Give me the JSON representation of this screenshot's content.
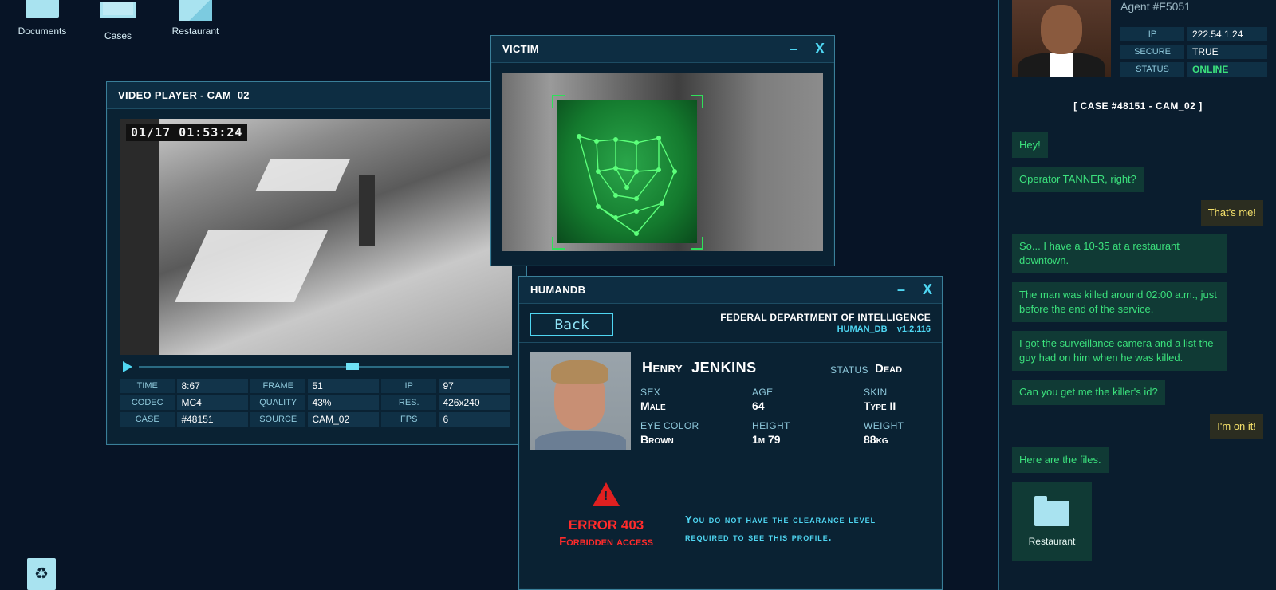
{
  "desktop": {
    "icons": [
      {
        "label": "Documents",
        "icon": "folder-icon"
      },
      {
        "label": "Cases",
        "icon": "tray-icon"
      },
      {
        "label": "Restaurant",
        "icon": "file-icon"
      }
    ],
    "recycle_icon": "recycle-bin-icon"
  },
  "video_player": {
    "title": "VIDEO PLAYER - CAM_02",
    "timestamp": "01/17 01:53:24",
    "progress": 0.58,
    "rows": [
      [
        {
          "k": "TIME",
          "v": "8:67"
        },
        {
          "k": "FRAME",
          "v": "51"
        },
        {
          "k": "IP",
          "v": "97"
        }
      ],
      [
        {
          "k": "CODEC",
          "v": "MC4"
        },
        {
          "k": "QUALITY",
          "v": "43%"
        },
        {
          "k": "RES.",
          "v": "426x240"
        }
      ],
      [
        {
          "k": "CASE",
          "v": "#48151"
        },
        {
          "k": "SOURCE",
          "v": "CAM_02"
        },
        {
          "k": "FPS",
          "v": "6"
        }
      ]
    ]
  },
  "victim": {
    "title": "VICTIM",
    "minimize": "–",
    "close": "X"
  },
  "humandb": {
    "title": "HUMANDB",
    "minimize": "–",
    "close": "X",
    "back_label": "Back",
    "agency": "FEDERAL DEPARTMENT OF INTELLIGENCE",
    "db_name": "HUMAN_DB",
    "version": "v1.2.116",
    "first_name": "Henry",
    "last_name": "JENKINS",
    "status_key": "STATUS",
    "status_value": "Dead",
    "fields": {
      "sex": {
        "k": "SEX",
        "v": "Male"
      },
      "age": {
        "k": "AGE",
        "v": "64"
      },
      "skin": {
        "k": "SKIN",
        "v": "Type II"
      },
      "eye": {
        "k": "EYE COLOR",
        "v": "Brown"
      },
      "height": {
        "k": "HEIGHT",
        "v": "1m 79"
      },
      "weight": {
        "k": "WEIGHT",
        "v": "88kg"
      }
    },
    "error_code": "ERROR 403",
    "error_text": "Forbidden access",
    "clearance_msg_1": "You do not have the clearance level",
    "clearance_msg_2": "required to see this profile."
  },
  "chat": {
    "agent_name": "Agent #F5051",
    "agent_info": [
      {
        "k": "IP",
        "v": "222.54.1.24"
      },
      {
        "k": "SECURE",
        "v": "TRUE"
      },
      {
        "k": "STATUS",
        "v": "ONLINE"
      }
    ],
    "status_color": "#3be07c",
    "case_header": "[   CASE #48151 - CAM_02   ]",
    "messages": [
      {
        "from": "them",
        "text": "Hey!"
      },
      {
        "from": "them",
        "text": "Operator TANNER, right?"
      },
      {
        "from": "me",
        "text": "That's me!"
      },
      {
        "from": "them",
        "text": "So... I have a 10-35 at a restaurant downtown."
      },
      {
        "from": "them",
        "text": "The man was killed around 02:00 a.m., just before the end of the service."
      },
      {
        "from": "them",
        "text": "I got the surveillance camera and a list the guy had on him when he was killed."
      },
      {
        "from": "them",
        "text": "Can you get me the killer's id?"
      },
      {
        "from": "me",
        "text": "I'm on it!"
      },
      {
        "from": "them",
        "text": "Here are the files."
      }
    ],
    "file_label": "Restaurant"
  }
}
